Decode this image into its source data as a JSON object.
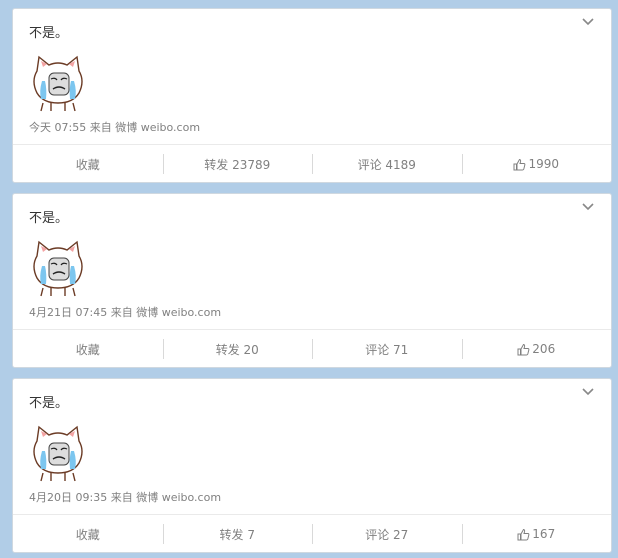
{
  "posts": [
    {
      "text": "不是。",
      "time": "今天 07:55",
      "from_label": "来自",
      "source_label": "微博 weibo.com",
      "actions": {
        "fav": "收藏",
        "repost": "转发 23789",
        "comment": "评论 4189",
        "like": "1990"
      }
    },
    {
      "text": "不是。",
      "time": "4月21日 07:45",
      "from_label": "来自",
      "source_label": "微博 weibo.com",
      "actions": {
        "fav": "收藏",
        "repost": "转发 20",
        "comment": "评论 71",
        "like": "206"
      }
    },
    {
      "text": "不是。",
      "time": "4月20日 09:35",
      "from_label": "来自",
      "source_label": "微博 weibo.com",
      "actions": {
        "fav": "收藏",
        "repost": "转发 7",
        "comment": "评论 27",
        "like": "167"
      }
    }
  ],
  "icons": {
    "menu": "chevron-down-icon",
    "like": "thumbs-up-icon",
    "emoji": "crying-cat-emoji-icon"
  },
  "colors": {
    "background": "#b1cde7",
    "card": "#ffffff",
    "muted_text": "#808080"
  }
}
